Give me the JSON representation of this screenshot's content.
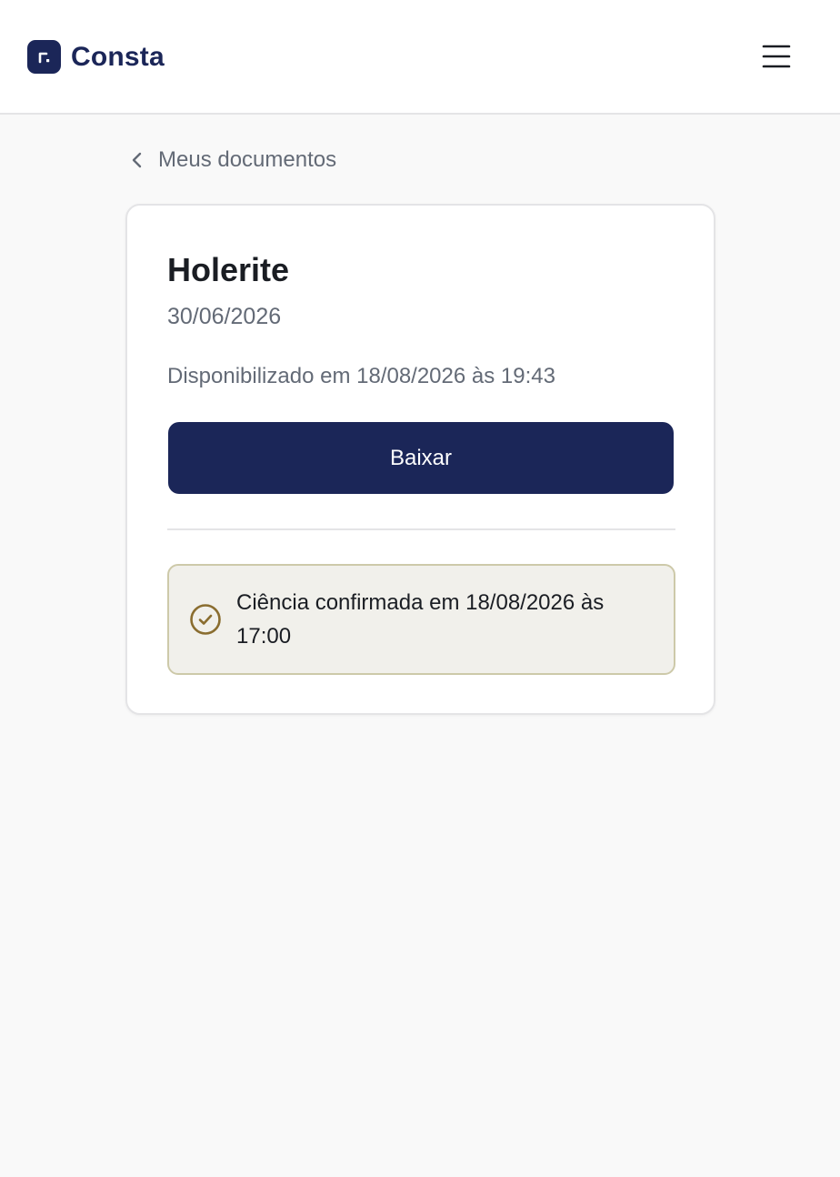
{
  "header": {
    "logo_text": "Consta",
    "logo_icon": "consta-logo-icon",
    "menu_icon": "hamburger-menu-icon"
  },
  "breadcrumb": {
    "back_icon": "chevron-left-icon",
    "label": "Meus documentos"
  },
  "document": {
    "title": "Holerite",
    "date": "30/06/2026",
    "available": "Disponibilizado em 18/08/2026 às 19:43",
    "download_label": "Baixar"
  },
  "acknowledgement": {
    "icon": "check-circle-icon",
    "text": "Ciência confirmada em 18/08/2026 às 17:00"
  },
  "colors": {
    "brand": "#1b2658",
    "page_background": "#f9f9f9",
    "muted_text": "#636a76",
    "ack_background": "#f1f0eb",
    "ack_border": "#cdc9a9",
    "ack_icon": "#8a6d2f"
  }
}
